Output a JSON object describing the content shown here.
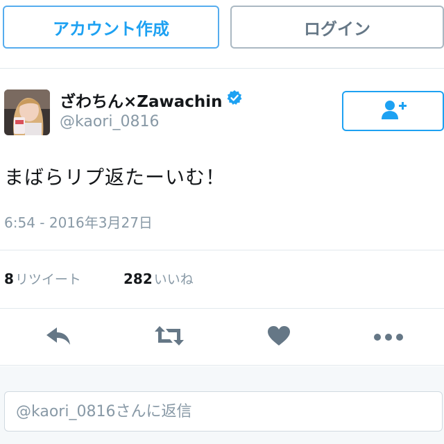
{
  "header": {
    "signup_label": "アカウント作成",
    "login_label": "ログイン"
  },
  "tweet": {
    "display_name": "ざわちん×Zawachin",
    "handle": "@kaori_0816",
    "verified": true,
    "text": "まばらリプ返たーいむ！",
    "timestamp": "6:54 - 2016年3月27日",
    "retweets": {
      "count": "8",
      "label": "リツイート"
    },
    "likes": {
      "count": "282",
      "label": "いいね"
    }
  },
  "actions": {
    "reply_icon": "reply-icon",
    "retweet_icon": "retweet-icon",
    "like_icon": "heart-icon",
    "more_icon": "more-icon"
  },
  "reply": {
    "placeholder": "@kaori_0816さんに返信"
  },
  "colors": {
    "accent": "#1da1f2",
    "muted": "#8899a6",
    "icon_gray": "#657786",
    "divider": "#e1e8ed",
    "reply_bg": "#f5f8fa"
  }
}
